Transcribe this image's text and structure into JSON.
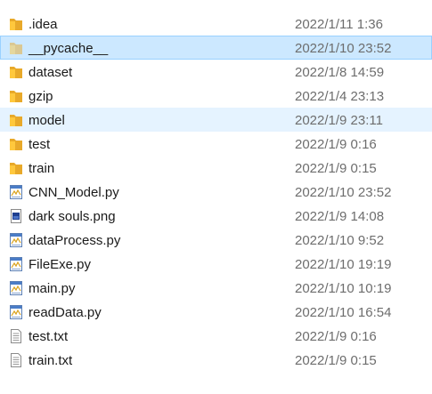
{
  "files": [
    {
      "name": ".idea",
      "date": "2022/1/11 1:36",
      "icon": "folder-icon",
      "state": ""
    },
    {
      "name": "__pycache__",
      "date": "2022/1/10 23:52",
      "icon": "folder-faded-icon",
      "state": "selected"
    },
    {
      "name": "dataset",
      "date": "2022/1/8 14:59",
      "icon": "folder-icon",
      "state": ""
    },
    {
      "name": "gzip",
      "date": "2022/1/4 23:13",
      "icon": "folder-icon",
      "state": ""
    },
    {
      "name": "model",
      "date": "2022/1/9 23:11",
      "icon": "folder-icon",
      "state": "hover"
    },
    {
      "name": "test",
      "date": "2022/1/9 0:16",
      "icon": "folder-icon",
      "state": ""
    },
    {
      "name": "train",
      "date": "2022/1/9 0:15",
      "icon": "folder-icon",
      "state": ""
    },
    {
      "name": "CNN_Model.py",
      "date": "2022/1/10 23:52",
      "icon": "python-file-icon",
      "state": ""
    },
    {
      "name": "dark souls.png",
      "date": "2022/1/9 14:08",
      "icon": "image-file-icon",
      "state": ""
    },
    {
      "name": "dataProcess.py",
      "date": "2022/1/10 9:52",
      "icon": "python-file-icon",
      "state": ""
    },
    {
      "name": "FileExe.py",
      "date": "2022/1/10 19:19",
      "icon": "python-file-icon",
      "state": ""
    },
    {
      "name": "main.py",
      "date": "2022/1/10 10:19",
      "icon": "python-file-icon",
      "state": ""
    },
    {
      "name": "readData.py",
      "date": "2022/1/10 16:54",
      "icon": "python-file-icon",
      "state": ""
    },
    {
      "name": "test.txt",
      "date": "2022/1/9 0:16",
      "icon": "text-file-icon",
      "state": ""
    },
    {
      "name": "train.txt",
      "date": "2022/1/9 0:15",
      "icon": "text-file-icon",
      "state": ""
    }
  ],
  "colors": {
    "folder": "#ffc83d",
    "folder_dark": "#e8a92a",
    "selected_bg": "#cce8ff",
    "hover_bg": "#e5f3ff",
    "date_text": "#6d6d6d"
  }
}
